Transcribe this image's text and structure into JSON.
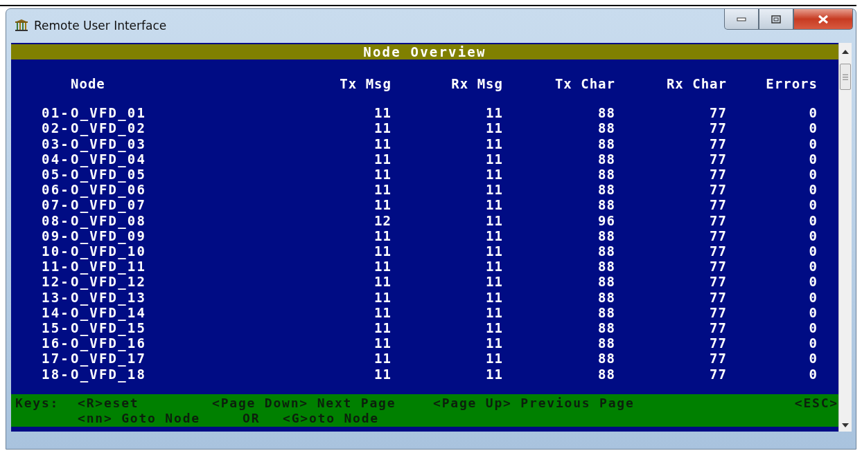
{
  "window": {
    "title": "Remote User Interface"
  },
  "console": {
    "title": "Node Overview",
    "columns": [
      "Node",
      "Tx Msg",
      "Rx Msg",
      "Tx Char",
      "Rx Char",
      "Errors"
    ],
    "rows": [
      {
        "num": "01-",
        "node": "O_VFD_01",
        "tx_msg": "11",
        "rx_msg": "11",
        "tx_char": "88",
        "rx_char": "77",
        "errors": "0"
      },
      {
        "num": "02-",
        "node": "O_VFD_02",
        "tx_msg": "11",
        "rx_msg": "11",
        "tx_char": "88",
        "rx_char": "77",
        "errors": "0"
      },
      {
        "num": "03-",
        "node": "O_VFD_03",
        "tx_msg": "11",
        "rx_msg": "11",
        "tx_char": "88",
        "rx_char": "77",
        "errors": "0"
      },
      {
        "num": "04-",
        "node": "O_VFD_04",
        "tx_msg": "11",
        "rx_msg": "11",
        "tx_char": "88",
        "rx_char": "77",
        "errors": "0"
      },
      {
        "num": "05-",
        "node": "O_VFD_05",
        "tx_msg": "11",
        "rx_msg": "11",
        "tx_char": "88",
        "rx_char": "77",
        "errors": "0"
      },
      {
        "num": "06-",
        "node": "O_VFD_06",
        "tx_msg": "11",
        "rx_msg": "11",
        "tx_char": "88",
        "rx_char": "77",
        "errors": "0"
      },
      {
        "num": "07-",
        "node": "O_VFD_07",
        "tx_msg": "11",
        "rx_msg": "11",
        "tx_char": "88",
        "rx_char": "77",
        "errors": "0"
      },
      {
        "num": "08-",
        "node": "O_VFD_08",
        "tx_msg": "12",
        "rx_msg": "11",
        "tx_char": "96",
        "rx_char": "77",
        "errors": "0"
      },
      {
        "num": "09-",
        "node": "O_VFD_09",
        "tx_msg": "11",
        "rx_msg": "11",
        "tx_char": "88",
        "rx_char": "77",
        "errors": "0"
      },
      {
        "num": "10-",
        "node": "O_VFD_10",
        "tx_msg": "11",
        "rx_msg": "11",
        "tx_char": "88",
        "rx_char": "77",
        "errors": "0"
      },
      {
        "num": "11-",
        "node": "O_VFD_11",
        "tx_msg": "11",
        "rx_msg": "11",
        "tx_char": "88",
        "rx_char": "77",
        "errors": "0"
      },
      {
        "num": "12-",
        "node": "O_VFD_12",
        "tx_msg": "11",
        "rx_msg": "11",
        "tx_char": "88",
        "rx_char": "77",
        "errors": "0"
      },
      {
        "num": "13-",
        "node": "O_VFD_13",
        "tx_msg": "11",
        "rx_msg": "11",
        "tx_char": "88",
        "rx_char": "77",
        "errors": "0"
      },
      {
        "num": "14-",
        "node": "O_VFD_14",
        "tx_msg": "11",
        "rx_msg": "11",
        "tx_char": "88",
        "rx_char": "77",
        "errors": "0"
      },
      {
        "num": "15-",
        "node": "O_VFD_15",
        "tx_msg": "11",
        "rx_msg": "11",
        "tx_char": "88",
        "rx_char": "77",
        "errors": "0"
      },
      {
        "num": "16-",
        "node": "O_VFD_16",
        "tx_msg": "11",
        "rx_msg": "11",
        "tx_char": "88",
        "rx_char": "77",
        "errors": "0"
      },
      {
        "num": "17-",
        "node": "O_VFD_17",
        "tx_msg": "11",
        "rx_msg": "11",
        "tx_char": "88",
        "rx_char": "77",
        "errors": "0"
      },
      {
        "num": "18-",
        "node": "O_VFD_18",
        "tx_msg": "11",
        "rx_msg": "11",
        "tx_char": "88",
        "rx_char": "77",
        "errors": "0"
      }
    ],
    "keys": [
      [
        "Keys:",
        "<R>eset",
        "<Page Down> Next Page",
        "<Page Up> Previous Page",
        "<ESC>"
      ],
      [
        "<nn> Goto Node",
        "OR",
        "<G>oto Node"
      ]
    ]
  }
}
